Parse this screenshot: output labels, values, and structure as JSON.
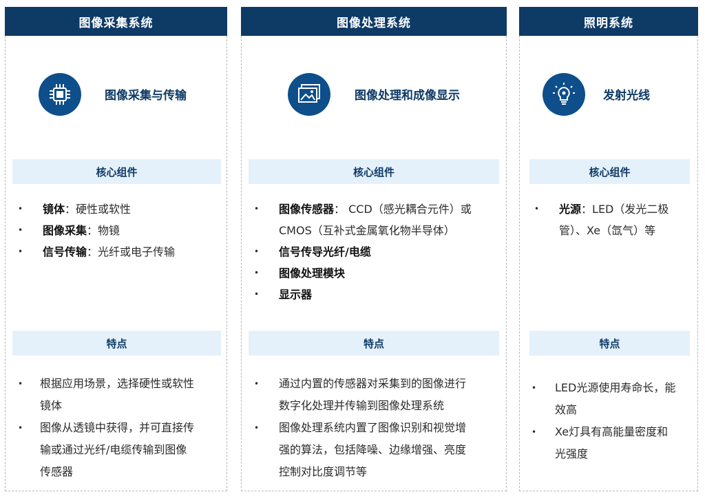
{
  "columns": [
    {
      "header": "图像采集系统",
      "icon": "cpu-chip-icon",
      "icon_title": "图像采集与传输",
      "components_label": "核心组件",
      "components": [
        {
          "bold": "镜体",
          "sep": "：",
          "text": "硬性或软性"
        },
        {
          "bold": "图像采集",
          "sep": "：",
          "text": "物镜"
        },
        {
          "bold": "信号传输",
          "sep": "：",
          "text": "光纤或电子传输"
        }
      ],
      "features_label": "特点",
      "features": [
        {
          "lines": [
            "根据应用场景，选择硬性或软性",
            "镜体"
          ]
        },
        {
          "lines": [
            "图像从透镜中获得，并可直接传",
            "输或通过光纤/电缆传输到图像",
            "传感器"
          ]
        }
      ]
    },
    {
      "header": "图像处理系统",
      "icon": "image-gallery-icon",
      "icon_title": "图像处理和成像显示",
      "components_label": "核心组件",
      "components": [
        {
          "bold": "图像传感器",
          "sep": "：",
          "lines": [
            "CCD（感光耦合元件）或",
            "CMOS（互补式金属氧化物半导体）"
          ]
        },
        {
          "bold": "信号传导光纤/电缆",
          "sep": "",
          "text": ""
        },
        {
          "bold": "图像处理模块",
          "sep": "",
          "text": ""
        },
        {
          "bold": "显示器",
          "sep": "",
          "text": ""
        }
      ],
      "features_label": "特点",
      "features": [
        {
          "lines": [
            "通过内置的传感器对采集到的图像进行",
            "数字化处理并传输到图像处理系统"
          ]
        },
        {
          "lines": [
            "图像处理系统内置了图像识别和视觉增",
            "强的算法，包括降噪、边缘增强、亮度",
            "控制对比度调节等"
          ]
        }
      ]
    },
    {
      "header": "照明系统",
      "icon": "light-bulb-icon",
      "icon_title": "发射光线",
      "components_label": "核心组件",
      "components": [
        {
          "bold": "光源",
          "sep": "：",
          "lines": [
            "LED（发光二极",
            "管）、Xe（氙气）等"
          ]
        }
      ],
      "features_label": "特点",
      "features": [
        {
          "lines": [
            "LED光源使用寿命长，能",
            "效高"
          ]
        },
        {
          "lines": [
            "Xe灯具有高能量密度和",
            "光强度"
          ]
        }
      ]
    }
  ],
  "colors": {
    "header_bg": "#0e3a66",
    "icon_bg": "#0e4e8a",
    "band_bg": "#e4f1fb"
  }
}
